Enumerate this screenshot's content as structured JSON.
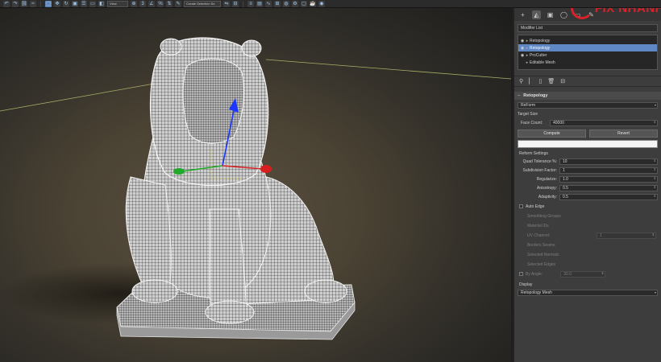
{
  "toolbar": {
    "view_dropdown": "View",
    "selection_set": "Create Selection Se",
    "icons": [
      "undo-icon",
      "redo-icon",
      "select-link-icon",
      "unlink-icon",
      "bind-space-warp-icon",
      "filter-icon",
      "select-object-icon",
      "select-by-name-icon",
      "rectangle-select-icon",
      "window-crossing-icon",
      "move-icon",
      "rotate-icon",
      "scale-icon",
      "reference-coord-icon",
      "pivot-icon",
      "snap-icon",
      "angle-snap-icon",
      "percent-snap-icon",
      "spinner-snap-icon",
      "edit-named-sel-icon",
      "mirror-icon",
      "align-icon",
      "layer-explorer-icon",
      "curve-editor-icon",
      "schematic-view-icon",
      "material-editor-icon",
      "render-setup-icon",
      "render-frame-icon",
      "render-icon"
    ]
  },
  "watermark": {
    "text": "FIX NHANH",
    "color": "#d8232a"
  },
  "panel": {
    "tabs": [
      "create-tab",
      "modify-tab",
      "hierarchy-tab",
      "motion-tab",
      "display-tab",
      "utilities-tab"
    ],
    "modifier_list": "Modifier List",
    "stack": [
      {
        "label": "Retopology",
        "selected": false
      },
      {
        "label": "Retopology",
        "selected": true
      },
      {
        "label": "ProCutter",
        "selected": false
      },
      {
        "label": "Editable Mesh",
        "selected": false
      }
    ],
    "rollout_title": "Retopology",
    "method": "ReForm",
    "target_size_label": "Target Size",
    "face_count_label": "Face Count:",
    "face_count": "40000",
    "compute_label": "Compute",
    "revert_label": "Revert",
    "progress": 0,
    "reform_settings_label": "Reform Settings",
    "quad_tolerance_label": "Quad Tolerance %:",
    "quad_tolerance": "10",
    "subdivision_label": "Subdivision Factor:",
    "subdivision": "1",
    "regularize_label": "Regularize:",
    "regularize": "1.0",
    "anisotropy_label": "Anisotropy:",
    "anisotropy": "0.5",
    "adaptivity_label": "Adaptivity:",
    "adaptivity": "0.5",
    "auto_edge_label": "Auto Edge",
    "auto_edge_checked": false,
    "smoothing_groups_label": "Smoothing Groups",
    "material_ids_label": "Material IDs",
    "uv_channel_label": "UV Channel:",
    "uv_channel": "1",
    "borders_label": "Borders Seams",
    "selected_normals_label": "Selected Normals",
    "selected_edges_label": "Selected Edges",
    "by_angle_label": "By Angle:",
    "by_angle": "30.0",
    "by_angle_checked": true,
    "display_label": "Display",
    "display_mode": "Retopology Mesh"
  },
  "colors": {
    "selection_highlight": "#5f87c4",
    "gizmo_x": "#d62020",
    "gizmo_y": "#1faa2c",
    "gizmo_z": "#1a36ff"
  }
}
